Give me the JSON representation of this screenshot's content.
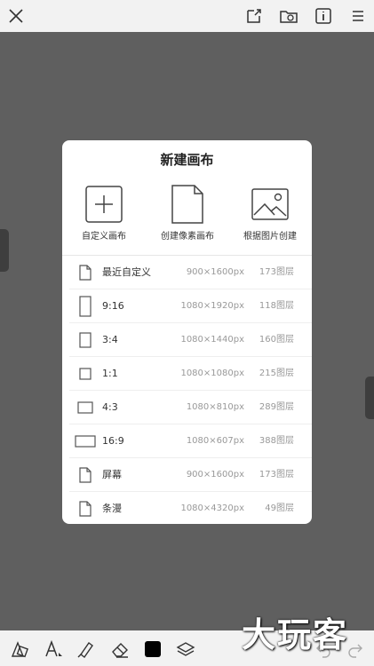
{
  "topbar": {
    "icons": [
      "close-icon",
      "export-icon",
      "folder-image-icon",
      "info-icon",
      "menu-icon"
    ]
  },
  "dialog": {
    "title": "新建画布",
    "options": [
      {
        "label": "自定义画布",
        "icon": "plus-square-icon"
      },
      {
        "label": "创建像素画布",
        "icon": "document-icon"
      },
      {
        "label": "根据图片创建",
        "icon": "image-icon"
      }
    ],
    "presets": [
      {
        "name": "最近自定义",
        "size": "900×1600px",
        "layers": "173图层",
        "icon": "document-icon"
      },
      {
        "name": "9:16",
        "size": "1080×1920px",
        "layers": "118图层",
        "icon": "ratio-9-16-icon"
      },
      {
        "name": "3:4",
        "size": "1080×1440px",
        "layers": "160图层",
        "icon": "ratio-3-4-icon"
      },
      {
        "name": "1:1",
        "size": "1080×1080px",
        "layers": "215图层",
        "icon": "ratio-1-1-icon"
      },
      {
        "name": "4:3",
        "size": "1080×810px",
        "layers": "289图层",
        "icon": "ratio-4-3-icon"
      },
      {
        "name": "16:9",
        "size": "1080×607px",
        "layers": "388图层",
        "icon": "ratio-16-9-icon"
      },
      {
        "name": "屏幕",
        "size": "900×1600px",
        "layers": "173图层",
        "icon": "document-icon"
      },
      {
        "name": "条漫",
        "size": "1080×4320px",
        "layers": "49图层",
        "icon": "document-icon"
      }
    ]
  },
  "bottombar": {
    "icons": [
      "shapes-icon",
      "text-tool-icon",
      "brush-icon",
      "eraser-icon",
      "color-swatch-icon",
      "layers-icon",
      "undo-icon",
      "redo-icon"
    ],
    "swatch_color": "#000000"
  },
  "watermark": "大玩客"
}
